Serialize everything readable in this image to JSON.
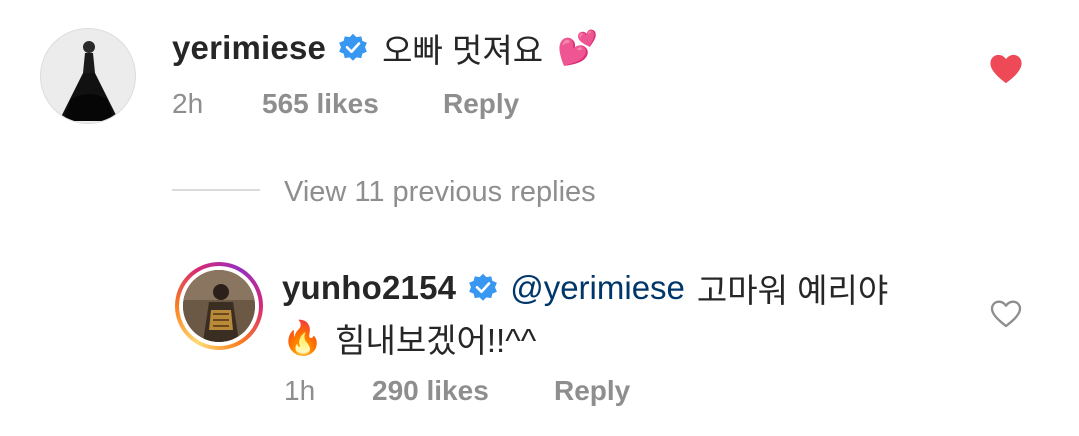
{
  "comment": {
    "username": "yerimiese",
    "text": "오빠 멋져요",
    "emoji": "💕",
    "time": "2h",
    "likes": "565 likes",
    "reply_label": "Reply",
    "liked": true,
    "heart_color": "#ed4956"
  },
  "view_replies": {
    "label": "View 11 previous replies"
  },
  "reply": {
    "username": "yunho2154",
    "mention": "@yerimiese",
    "text_line1": "고마워 예리야",
    "emoji": "🔥",
    "text_line2": "힘내보겠어!!^^",
    "time": "1h",
    "likes": "290 likes",
    "reply_label": "Reply",
    "liked": false
  },
  "colors": {
    "verified_badge": "#3897f0",
    "meta_text": "#8e8e8e",
    "mention": "#00376b"
  }
}
